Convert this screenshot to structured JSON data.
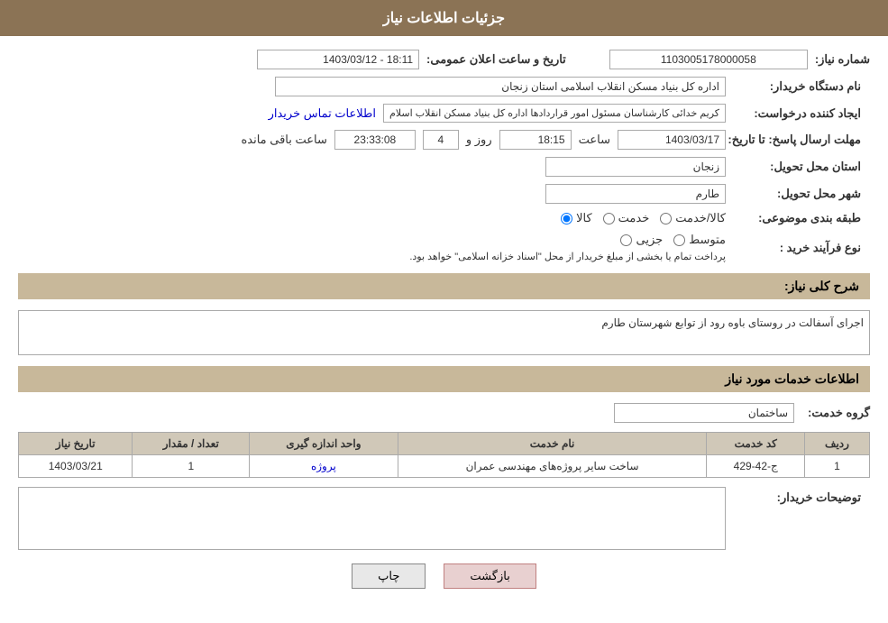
{
  "header": {
    "title": "جزئیات اطلاعات نیاز"
  },
  "form": {
    "need_number_label": "شماره نیاز:",
    "need_number_value": "1103005178000058",
    "announce_date_label": "تاریخ و ساعت اعلان عمومی:",
    "announce_date_value": "18:11 - 1403/03/12",
    "buyer_name_label": "نام دستگاه خریدار:",
    "buyer_name_value": "اداره کل بنیاد مسکن انقلاب اسلامی استان زنجان",
    "creator_label": "ایجاد کننده درخواست:",
    "creator_value": "کریم خدائی کارشناسان مسئول امور قراردادها اداره کل بنیاد مسکن انقلاب اسلام",
    "contact_link": "اطلاعات تماس خریدار",
    "deadline_label": "مهلت ارسال پاسخ: تا تاریخ:",
    "deadline_date": "1403/03/17",
    "deadline_time_label": "ساعت",
    "deadline_time": "18:15",
    "deadline_days_label": "روز و",
    "deadline_days": "4",
    "deadline_remaining_label": "ساعت باقی مانده",
    "deadline_remaining": "23:33:08",
    "province_label": "استان محل تحویل:",
    "province_value": "زنجان",
    "city_label": "شهر محل تحویل:",
    "city_value": "طارم",
    "category_label": "طبقه بندی موضوعی:",
    "category_options": [
      "کالا",
      "خدمت",
      "کالا/خدمت"
    ],
    "category_selected": "کالا",
    "process_label": "نوع فرآیند خرید :",
    "process_options": [
      "جزیی",
      "متوسط"
    ],
    "process_note": "پرداخت تمام یا بخشی از مبلغ خریدار از محل \"اسناد خزانه اسلامی\" خواهد بود.",
    "description_section": "شرح کلی نیاز:",
    "description_value": "اجرای آسفالت در روستای   باوه رود از توابع شهرستان طارم",
    "services_section": "اطلاعات خدمات مورد نیاز",
    "service_group_label": "گروه خدمت:",
    "service_group_value": "ساختمان",
    "table": {
      "headers": [
        "ردیف",
        "کد خدمت",
        "نام خدمت",
        "واحد اندازه گیری",
        "تعداد / مقدار",
        "تاریخ نیاز"
      ],
      "rows": [
        {
          "row": "1",
          "code": "ج-42-429",
          "name": "ساخت سایر پروژه‌های مهندسی عمران",
          "unit": "پروژه",
          "quantity": "1",
          "date": "1403/03/21"
        }
      ]
    },
    "buyer_notes_label": "توضیحات خریدار:",
    "buyer_notes_value": "",
    "btn_print": "چاپ",
    "btn_back": "بازگشت"
  }
}
